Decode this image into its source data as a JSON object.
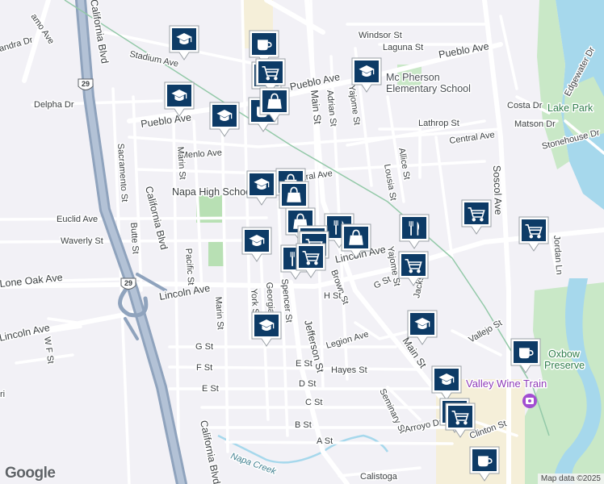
{
  "map": {
    "provider_logo": "Google",
    "attribution": "Map data ©2025",
    "colors": {
      "land": "#f2f1f6",
      "park": "#c9e8c7",
      "water": "#a6d8ec",
      "highway": "#8fa3bd",
      "road": "#ffffff",
      "pin": "#0d3b66",
      "rail": "#93c9a8"
    }
  },
  "labels": {
    "napa_high": "Napa High School",
    "mcpherson_1": "Mc Pherson",
    "mcpherson_2": "Elementary School",
    "lake_park": "Lake Park",
    "oxbow_1": "Oxbow",
    "oxbow_2": "Preserve",
    "valley_wine_train": "Valley Wine Train",
    "napa_creek": "Napa Creek",
    "california_blvd_1": "California Blvd",
    "california_blvd_2": "California Blvd",
    "california_blvd_3": "California Blvd",
    "lincoln_ave_1": "Lincoln Ave",
    "lincoln_ave_2": "Lincoln Ave",
    "lincoln_ave_3": "Lincoln Ave",
    "pueblo_ave_1": "Pueblo Ave",
    "pueblo_ave_2": "Pueblo Ave",
    "pueblo_ave_3": "Pueblo Ave",
    "lone_oak_ave": "Lone Oak Ave",
    "jefferson_st": "Jefferson St",
    "main_st_1": "Main St",
    "main_st_2": "Main St",
    "soscol_ave": "Soscol Ave",
    "stadium_ave": "Stadium Ave",
    "delpha_dr": "Delpha Dr",
    "menlo_ave": "Menlo Ave",
    "central_ave_1": "Central Ave",
    "central_ave_2": "ntral Ave",
    "euclid_ave": "Euclid Ave",
    "waverly_st": "Waverly St",
    "sacramento_st": "Sacramento St",
    "butte_st": "Butte St",
    "marin_st_1": "Marin St",
    "marin_st_2": "Marin St",
    "pacific_st": "Pacific St",
    "york_st": "York St",
    "georgia_st": "Georgia St",
    "spencer_st": "Spencer St",
    "brown_st": "Brown St",
    "adrian_st": "Adrian St",
    "yajome_st_1": "Yajome St",
    "yajome_st_2": "Yajome St",
    "lousia_st": "Lousia St",
    "allice_st": "Allice St",
    "jackson_st": "Jackson St",
    "seminary_st": "Seminary St",
    "vallejo_st": "Vallejo St",
    "clinton_st": "Clinton St",
    "arroyo_dr": "Arroyo Dr",
    "calistoga": "Calistoga",
    "windsor_st": "Windsor St",
    "laguna_st": "Laguna St",
    "lathrop_st": "Lathrop St",
    "costa_dr": "Costa Dr",
    "matson_dr": "Matson Dr",
    "edgewater_dr": "Edgewater Dr",
    "stonehouse_dr": "Stonehouse Dr",
    "jordan_ln": "Jordan Ln",
    "legion_ave": "Legion Ave",
    "hayes_st": "Hayes St",
    "g_st_1": "G St",
    "g_st_2": "G St",
    "f_st": "F St",
    "e_st_1": "E St",
    "e_st_2": "E St",
    "d_st": "D St",
    "c_st": "C St",
    "b_st": "B St",
    "a_st": "A St",
    "w_f_st": "W F St",
    "h_st": "H St",
    "sandra_dr": "andra Dr",
    "ramo_ave": "amo Ave",
    "ri": "ri",
    "route_29_1": "29",
    "route_29_2": "29"
  },
  "markers": [
    {
      "type": "school",
      "icon": "graduation-cap-icon"
    },
    {
      "type": "cafe",
      "icon": "coffee-cup-icon"
    },
    {
      "type": "school",
      "icon": "graduation-cap-icon"
    },
    {
      "type": "grocery",
      "icon": "shopping-cart-icon"
    },
    {
      "type": "grocery",
      "icon": "shopping-cart-icon"
    },
    {
      "type": "school",
      "icon": "graduation-cap-icon"
    },
    {
      "type": "school",
      "icon": "graduation-cap-icon"
    },
    {
      "type": "cafe",
      "icon": "coffee-cup-icon"
    },
    {
      "type": "shopping",
      "icon": "shopping-bag-icon"
    },
    {
      "type": "school",
      "icon": "graduation-cap-icon"
    },
    {
      "type": "shopping",
      "icon": "shopping-bag-icon"
    },
    {
      "type": "shopping",
      "icon": "shopping-bag-icon"
    },
    {
      "type": "restaurant",
      "icon": "fork-knife-icon"
    },
    {
      "type": "shopping",
      "icon": "shopping-bag-icon"
    },
    {
      "type": "school",
      "icon": "graduation-cap-icon"
    },
    {
      "type": "shopping",
      "icon": "shopping-bag-icon"
    },
    {
      "type": "restaurant",
      "icon": "fork-knife-icon"
    },
    {
      "type": "grocery",
      "icon": "shopping-cart-icon"
    },
    {
      "type": "shopping",
      "icon": "shopping-bag-icon"
    },
    {
      "type": "restaurant",
      "icon": "fork-knife-icon"
    },
    {
      "type": "grocery",
      "icon": "shopping-cart-icon"
    },
    {
      "type": "grocery",
      "icon": "shopping-cart-icon"
    },
    {
      "type": "grocery",
      "icon": "shopping-cart-icon"
    },
    {
      "type": "school",
      "icon": "graduation-cap-icon"
    },
    {
      "type": "school",
      "icon": "graduation-cap-icon"
    },
    {
      "type": "cafe",
      "icon": "coffee-cup-icon"
    },
    {
      "type": "school",
      "icon": "graduation-cap-icon"
    },
    {
      "type": "grocery",
      "icon": "shopping-cart-icon"
    },
    {
      "type": "grocery",
      "icon": "shopping-cart-icon"
    },
    {
      "type": "cafe",
      "icon": "coffee-cup-icon"
    },
    {
      "type": "grocery",
      "icon": "shopping-cart-icon"
    }
  ]
}
